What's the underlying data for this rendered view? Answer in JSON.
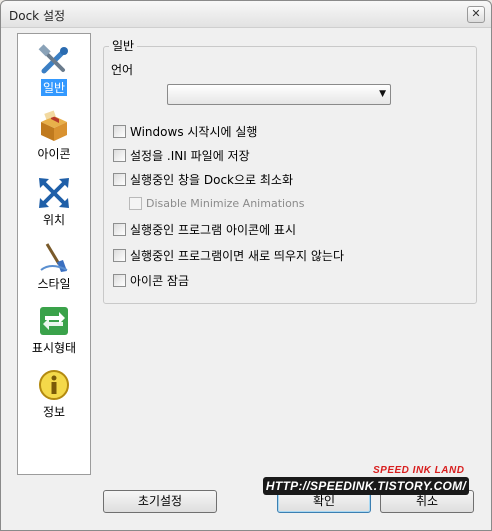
{
  "window": {
    "title": "Dock 설정",
    "close_label": "✕"
  },
  "sidebar": {
    "items": [
      {
        "label": "일반",
        "icon": "tools-icon",
        "selected": true
      },
      {
        "label": "아이콘",
        "icon": "package-icon",
        "selected": false
      },
      {
        "label": "위치",
        "icon": "move-arrows-icon",
        "selected": false
      },
      {
        "label": "스타일",
        "icon": "paintbrush-icon",
        "selected": false
      },
      {
        "label": "표시형태",
        "icon": "swap-arrows-icon",
        "selected": false
      },
      {
        "label": "정보",
        "icon": "info-icon",
        "selected": false
      }
    ]
  },
  "general": {
    "group_title": "일반",
    "language_label": "언어",
    "language_value": "",
    "options": [
      {
        "label": "Windows 시작시에 실행",
        "checked": false,
        "disabled": false
      },
      {
        "label": "설정을 .INI 파일에 저장",
        "checked": false,
        "disabled": false
      },
      {
        "label": "실행중인 창을 Dock으로 최소화",
        "checked": false,
        "disabled": false
      },
      {
        "label": "Disable Minimize Animations",
        "checked": false,
        "disabled": true
      },
      {
        "label": "실행중인 프로그램 아이콘에 표시",
        "checked": false,
        "disabled": false
      },
      {
        "label": "실행중인 프로그램이면 새로 띄우지 않는다",
        "checked": false,
        "disabled": false
      },
      {
        "label": "아이콘 잠금",
        "checked": false,
        "disabled": false
      }
    ]
  },
  "buttons": {
    "reset": "초기설정",
    "ok": "확인",
    "cancel": "취소"
  },
  "watermark": {
    "brand": "SPEED INK LAND",
    "url": "HTTP://SPEEDINK.TISTORY.COM/"
  },
  "colors": {
    "selection": "#3399ff",
    "watermark_red": "#d81e1e"
  }
}
